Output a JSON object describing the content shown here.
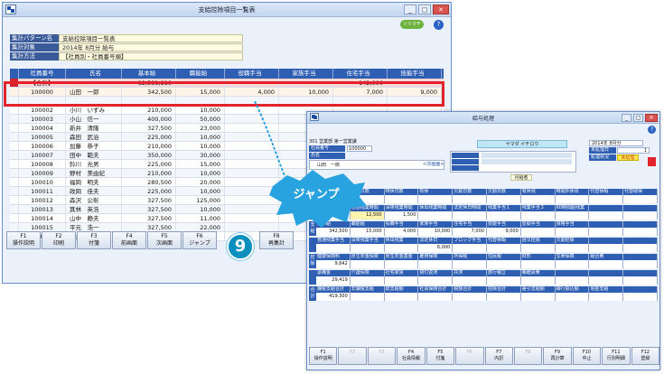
{
  "win1": {
    "title": "支給控除項目一覧表",
    "logo_text": "ソリマチ",
    "help": "?",
    "info": [
      {
        "label": "集計パターン名",
        "value": "支給控除項目一覧表"
      },
      {
        "label": "集計対象",
        "value": "2014年 8月分 給与"
      },
      {
        "label": "集計方法",
        "value": "【社員別・社員番号順】"
      }
    ],
    "columns": [
      "社員番号",
      "氏名",
      "基本給",
      "職能給",
      "役職手当",
      "家族手当",
      "住宅手当",
      "技能手当"
    ],
    "total_row": [
      "【合計】",
      "",
      "12,581,110",
      "",
      "",
      "",
      "142,000",
      ""
    ],
    "rows": [
      [
        "100000",
        "山田　一郎",
        "342,500",
        "15,000",
        "4,000",
        "10,000",
        "7,000",
        "9,000"
      ],
      [
        "",
        "",
        "",
        "",
        "",
        "",
        "",
        ""
      ],
      [
        "100002",
        "小川　いずみ",
        "210,000",
        "10,000",
        "",
        "",
        "",
        ""
      ],
      [
        "100003",
        "小山　信一",
        "400,000",
        "50,000",
        "",
        "",
        "",
        ""
      ],
      [
        "100004",
        "新井　清隆",
        "327,500",
        "23,000",
        "",
        "",
        "",
        ""
      ],
      [
        "100005",
        "森田　武治",
        "225,000",
        "10,000",
        "",
        "",
        "",
        ""
      ],
      [
        "100006",
        "加藤　恭子",
        "210,000",
        "10,000",
        "",
        "",
        "",
        ""
      ],
      [
        "100007",
        "田中　範夫",
        "350,000",
        "30,000",
        "",
        "",
        "",
        ""
      ],
      [
        "100008",
        "鈴川　光男",
        "225,000",
        "15,000",
        "",
        "",
        "",
        ""
      ],
      [
        "100009",
        "野村　美由紀",
        "210,000",
        "10,000",
        "",
        "",
        "",
        ""
      ],
      [
        "100010",
        "福岡　明夫",
        "280,500",
        "20,000",
        "",
        "",
        "",
        ""
      ],
      [
        "100011",
        "政岡　佳夫",
        "225,000",
        "10,000",
        "",
        "",
        "",
        ""
      ],
      [
        "100012",
        "森沢　公彰",
        "327,500",
        "125,000",
        "",
        "",
        "",
        ""
      ],
      [
        "100013",
        "箕林　英浩",
        "327,500",
        "10,000",
        "",
        "",
        "",
        ""
      ],
      [
        "100014",
        "山中　静夫",
        "327,500",
        "11,000",
        "",
        "",
        "",
        ""
      ],
      [
        "100015",
        "平元　浩一",
        "327,500",
        "22,000",
        "",
        "",
        "",
        ""
      ],
      [
        "100016",
        "福井　和栄",
        "327,500",
        "",
        "",
        "",
        "",
        ""
      ]
    ],
    "fkeys": [
      {
        "k": "F1",
        "l": "操作説明"
      },
      {
        "k": "F2",
        "l": "印刷"
      },
      {
        "k": "F3",
        "l": "付箋"
      },
      {
        "k": "F4",
        "l": "前画面"
      },
      {
        "k": "F5",
        "l": "次画面"
      },
      {
        "k": "F6",
        "l": "ジャンプ"
      }
    ],
    "fkeys_right": [
      {
        "k": "F8",
        "l": "再集計"
      }
    ]
  },
  "badge": "9",
  "jump_label": "ジャンプ",
  "arrow_color": "#29a3df",
  "win2": {
    "title": "給与処理",
    "help": "?",
    "dept": "301 営業部 第一営業課",
    "emp_label": "社員番号",
    "name_label": "氏名",
    "emp_no": "100000",
    "emp_name": "山田　一郎",
    "next_label": "<次画面>",
    "kana": "ヤマダ イチロウ",
    "pay_label": "月給者",
    "period_label": "2014年 8月分",
    "shift_label": "未処理日",
    "shift_val": "1",
    "status_label": "処理状況",
    "status_val": "未処理",
    "sections": [
      {
        "side": "勤怠",
        "hdr": [
          "出勤日数",
          "休出日数",
          "特休日数",
          "有休",
          "欠勤日数",
          "欠勤日数",
          "有休残",
          "時間外休出",
          "代替休暇",
          "代替取得"
        ],
        "val": [
          "21",
          "",
          "",
          "",
          "",
          "",
          "",
          "",
          "",
          ""
        ]
      },
      {
        "side": "",
        "hdr": [
          "遅早時間",
          "普通残業時間",
          "深夜残業時間",
          "休出残業時間",
          "法定休日時間",
          "残業手当１",
          "残業手当２",
          "60時間超残業",
          "",
          ""
        ],
        "val": [
          "",
          "12,500",
          "1,500",
          "",
          "",
          "",
          "",
          "",
          "",
          ""
        ]
      },
      {
        "side": "支給",
        "hdr": [
          "基本給",
          "職能給",
          "役職手当",
          "家族手当",
          "住宅手当",
          "技能手当",
          "皆勤手当",
          "資格手当",
          "",
          ""
        ],
        "val": [
          "342,500",
          "15,000",
          "4,000",
          "10,000",
          "7,000",
          "9,000",
          "",
          "",
          "",
          ""
        ]
      },
      {
        "side": "",
        "hdr": [
          "普通残業手当",
          "深夜残業手当",
          "休出残業",
          "法定休日",
          "ブロック手当",
          "代替休暇",
          "遅早控除",
          "欠勤控除",
          "",
          ""
        ],
        "val": [
          "",
          "",
          "",
          "6,000",
          "",
          "",
          "",
          "",
          "",
          ""
        ]
      },
      {
        "side": "控除",
        "hdr": [
          "健康保険料",
          "厚生年金保険",
          "厚生年金基金",
          "雇用保険",
          "所得税",
          "住民税",
          "財形",
          "生命保険",
          "組合費",
          ""
        ],
        "val": [
          "9,642",
          "",
          "",
          "",
          "",
          "",
          "",
          "",
          "",
          ""
        ]
      },
      {
        "side": "",
        "hdr": [
          "退職金",
          "介護保険",
          "社宅家賃",
          "貸付返済",
          "共済",
          "旅行積立",
          "親睦会費",
          "",
          "",
          ""
        ],
        "val": [
          "29,419",
          "",
          "",
          "",
          "",
          "",
          "",
          "",
          "",
          ""
        ]
      },
      {
        "side": "合計",
        "hdr": [
          "課税支給合計",
          "非課税支給",
          "総支給額",
          "社会保険合計",
          "税額合計",
          "控除合計",
          "差引支給額",
          "銀行振込額",
          "現金支給",
          ""
        ],
        "val": [
          "419,300",
          "",
          "",
          "",
          "",
          "",
          "",
          "",
          "",
          ""
        ]
      }
    ],
    "fkeys": [
      {
        "k": "F1",
        "l": "操作説明",
        "dim": false
      },
      {
        "k": "F2",
        "l": "",
        "dim": true
      },
      {
        "k": "F3",
        "l": "",
        "dim": true
      },
      {
        "k": "F4",
        "l": "社員情報",
        "dim": false
      },
      {
        "k": "F5",
        "l": "付箋",
        "dim": false
      },
      {
        "k": "F6",
        "l": "",
        "dim": true
      },
      {
        "k": "F7",
        "l": "内訳",
        "dim": false
      },
      {
        "k": "F8",
        "l": "",
        "dim": true
      },
      {
        "k": "F9",
        "l": "再計算",
        "dim": false
      },
      {
        "k": "F10",
        "l": "中止",
        "dim": false
      },
      {
        "k": "F11",
        "l": "行別明細",
        "dim": false
      },
      {
        "k": "F12",
        "l": "登録",
        "dim": false
      }
    ]
  }
}
